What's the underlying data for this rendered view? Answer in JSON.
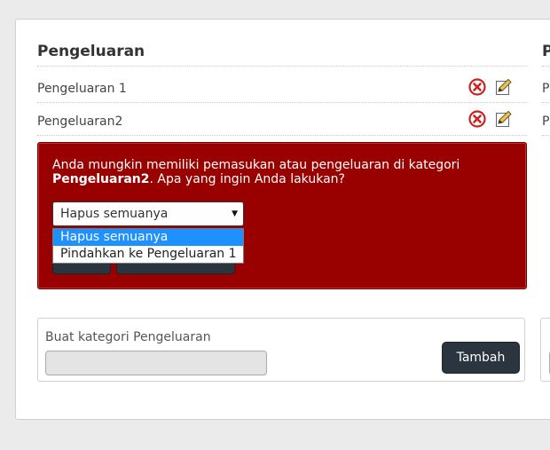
{
  "left_column": {
    "title": "Pengeluaran",
    "items": [
      {
        "label": "Pengeluaran 1"
      },
      {
        "label": "Pengeluaran2"
      }
    ]
  },
  "right_column": {
    "title": "P",
    "items": [
      {
        "label": "P"
      },
      {
        "label": "P"
      }
    ]
  },
  "alert": {
    "message_prefix": "Anda mungkin memiliki pemasukan atau pengeluaran di kategori ",
    "category_name": "Pengeluaran2",
    "message_suffix": ". Apa yang ingin Anda lakukan?",
    "select_value": "Hapus semuanya",
    "options": [
      "Hapus semuanya",
      "Pindahkan ke Pengeluaran 1"
    ]
  },
  "create_form": {
    "label": "Buat kategori Pengeluaran",
    "input_value": "",
    "add_button": "Tambah"
  },
  "icons": {
    "delete": "delete-icon",
    "edit": "edit-icon"
  },
  "colors": {
    "alert_bg": "#990000",
    "button_dark": "#2b3540",
    "option_selected": "#1e90ff",
    "delete_red": "#cc2222"
  }
}
